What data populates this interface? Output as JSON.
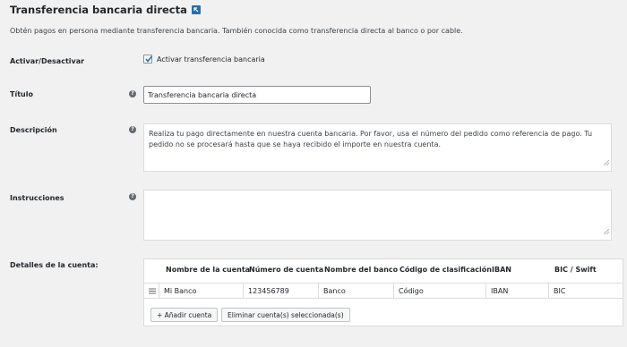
{
  "header": {
    "title": "Transferencia bancaria directa",
    "description": "Obtén pagos en persona mediante transferencia bancaria. También conocida como transferencia directa al banco o por cable."
  },
  "fields": {
    "enable": {
      "label": "Activar/Desactivar",
      "checkbox_label": "Activar transferencia bancaria",
      "checked": true
    },
    "title": {
      "label": "Título",
      "value": "Transferencia bancaria directa"
    },
    "description": {
      "label": "Descripción",
      "value": "Realiza tu pago directamente en nuestra cuenta bancaria. Por favor, usa el número del pedido como referencia de pago. Tu pedido no se procesará hasta que se haya recibido el importe en nuestra cuenta."
    },
    "instructions": {
      "label": "Instrucciones",
      "value": ""
    },
    "accounts": {
      "label": "Detalles de la cuenta:",
      "columns": [
        "Nombre de la cuenta",
        "Número de cuenta",
        "Nombre del banco",
        "Código de clasificación",
        "IBAN",
        "BIC / Swift"
      ],
      "rows": [
        [
          "Mi Banco",
          "123456789",
          "Banco",
          "Código",
          "IBAN",
          "BIC"
        ]
      ],
      "add_button": "+ Añadir cuenta",
      "remove_button": "Eliminar cuenta(s) seleccionada(s)"
    }
  },
  "icons": {
    "help": "help-icon",
    "return": "return-up-icon",
    "drag": "drag-handle-icon"
  },
  "colors": {
    "accent": "#2271b1",
    "background": "#f1f1f1"
  }
}
